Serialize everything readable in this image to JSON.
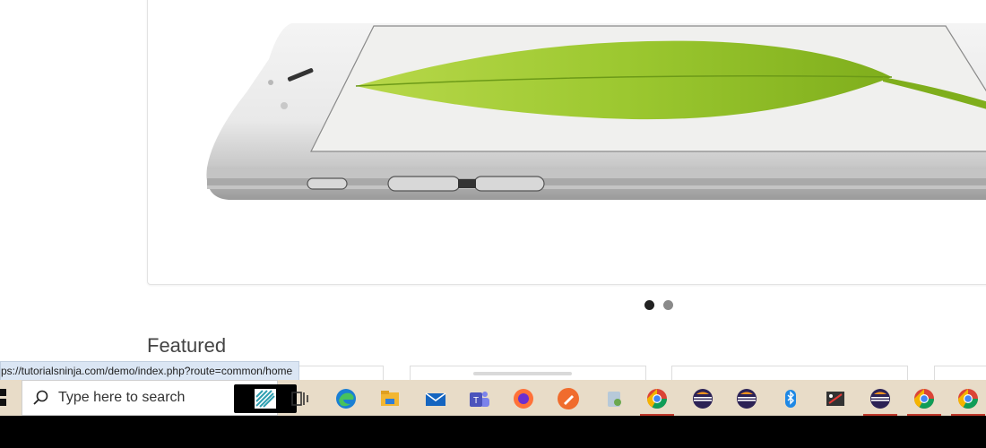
{
  "status_bar": {
    "url": "ps://tutorialsninja.com/demo/index.php?route=common/home"
  },
  "slideshow": {
    "pager": [
      "slide-1",
      "slide-2"
    ],
    "active_index": 0
  },
  "featured": {
    "title": "Featured"
  },
  "taskbar": {
    "search_placeholder": "Type here to search",
    "icons": [
      "windows-start-icon",
      "search-icon",
      "search-highlight-icon",
      "task-view-icon",
      "edge-icon",
      "file-explorer-icon",
      "mail-icon",
      "teams-icon",
      "firefox-icon",
      "pen-app-icon",
      "recycle-icon",
      "chrome-icon",
      "eclipse-icon",
      "eclipse-icon",
      "bluetooth-icon",
      "snipping-tool-icon",
      "eclipse-icon",
      "chrome-icon",
      "chrome-icon"
    ]
  },
  "colors": {
    "taskbar_bg": "#e8dcc8",
    "active_underline": "#c0392b",
    "status_bg": "#dbe6f4"
  }
}
